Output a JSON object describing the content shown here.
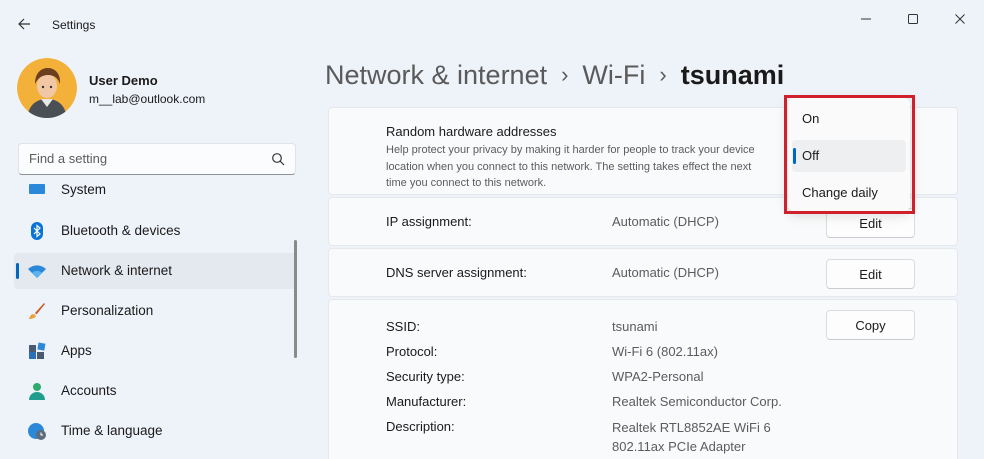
{
  "window": {
    "title": "Settings"
  },
  "profile": {
    "name": "User Demo",
    "email": "m__lab@outlook.com"
  },
  "search": {
    "placeholder": "Find a setting"
  },
  "sidebar": {
    "items": [
      {
        "label": "System",
        "icon": "system-icon"
      },
      {
        "label": "Bluetooth & devices",
        "icon": "bluetooth-icon"
      },
      {
        "label": "Network & internet",
        "icon": "wifi-icon",
        "active": true
      },
      {
        "label": "Personalization",
        "icon": "brush-icon"
      },
      {
        "label": "Apps",
        "icon": "apps-icon"
      },
      {
        "label": "Accounts",
        "icon": "person-icon"
      },
      {
        "label": "Time & language",
        "icon": "globe-clock-icon"
      }
    ]
  },
  "breadcrumb": {
    "part1": "Network & internet",
    "part2": "Wi-Fi",
    "current": "tsunami",
    "separator": "›"
  },
  "random_hw": {
    "title": "Random hardware addresses",
    "description": "Help protect your privacy by making it harder for people to track your device location when you connect to this network. The setting takes effect the next time you connect to this network."
  },
  "ip": {
    "label": "IP assignment:",
    "value": "Automatic (DHCP)",
    "button": "Edit"
  },
  "dns": {
    "label": "DNS server assignment:",
    "value": "Automatic (DHCP)",
    "button": "Edit"
  },
  "properties": {
    "copy_button": "Copy",
    "rows": [
      {
        "label": "SSID:",
        "value": "tsunami"
      },
      {
        "label": "Protocol:",
        "value": "Wi-Fi 6 (802.11ax)"
      },
      {
        "label": "Security type:",
        "value": "WPA2-Personal"
      },
      {
        "label": "Manufacturer:",
        "value": "Realtek Semiconductor Corp."
      },
      {
        "label": "Description:",
        "value": "Realtek RTL8852AE WiFi 6",
        "value2": "802.11ax PCIe Adapter"
      }
    ]
  },
  "dropdown": {
    "options": [
      "On",
      "Off",
      "Change daily"
    ],
    "selected": "Off"
  },
  "colors": {
    "accent": "#0067c0",
    "highlight": "#d0202c"
  }
}
